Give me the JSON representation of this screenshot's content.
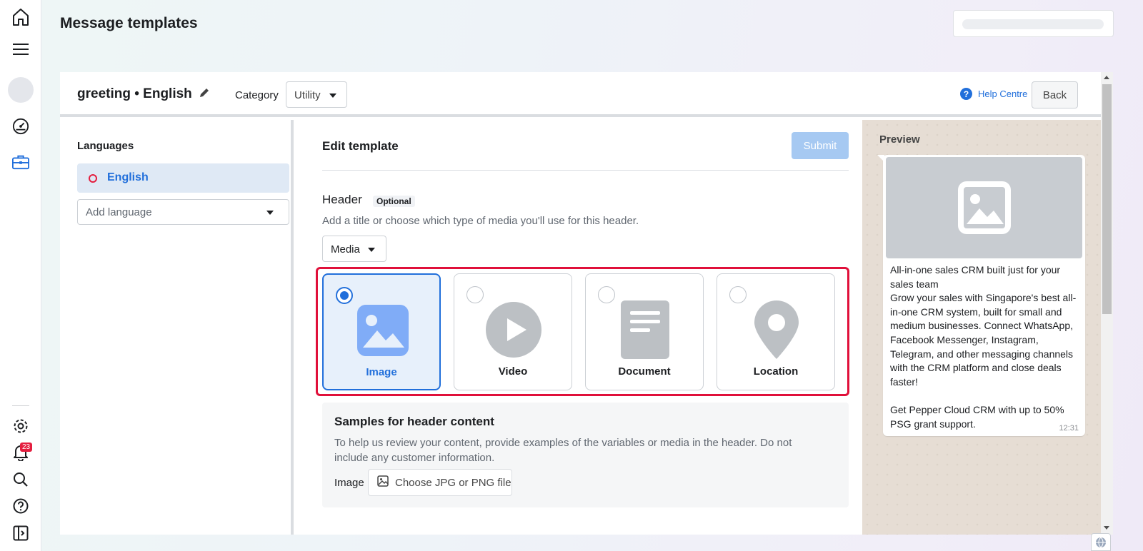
{
  "page": {
    "title": "Message templates"
  },
  "nav": {
    "notification_count": "23",
    "icons": [
      "home-icon",
      "menu-icon",
      "avatar",
      "dashboard-icon",
      "briefcase-icon",
      "settings-icon",
      "bell-icon",
      "search-icon",
      "help-icon",
      "sidebar-toggle-icon"
    ]
  },
  "template": {
    "name": "greeting • English",
    "category_label": "Category",
    "category_value": "Utility",
    "help_label": "Help Centre",
    "back_label": "Back"
  },
  "languages": {
    "title": "Languages",
    "selected": "English",
    "add_placeholder": "Add language"
  },
  "editor": {
    "title": "Edit template",
    "submit_label": "Submit",
    "header_label": "Header",
    "optional_badge": "Optional",
    "header_desc": "Add a title or choose which type of media you'll use for this header.",
    "header_type": "Media",
    "media_options": [
      {
        "label": "Image",
        "icon": "image-icon",
        "selected": true
      },
      {
        "label": "Video",
        "icon": "play-icon",
        "selected": false
      },
      {
        "label": "Document",
        "icon": "document-icon",
        "selected": false
      },
      {
        "label": "Location",
        "icon": "location-pin-icon",
        "selected": false
      }
    ],
    "samples_title": "Samples for header content",
    "samples_desc": "To help us review your content, provide examples of the variables or media in the header. Do not include any customer information.",
    "samples_image_label": "Image",
    "file_button_label": "Choose JPG or PNG file"
  },
  "preview": {
    "title": "Preview",
    "message": "All-in-one sales CRM built just for your sales team\nGrow your sales with Singapore's best all-in-one CRM system, built for small and medium businesses. Connect WhatsApp, Facebook Messenger, Instagram, Telegram, and other messaging channels with the CRM platform and close deals faster!\n\nGet Pepper Cloud CRM with up to 50% PSG grant support.",
    "time": "12:31"
  },
  "colors": {
    "accent": "#216fdb",
    "highlight": "#e0103a",
    "submit_disabled": "#a6c9f2"
  }
}
